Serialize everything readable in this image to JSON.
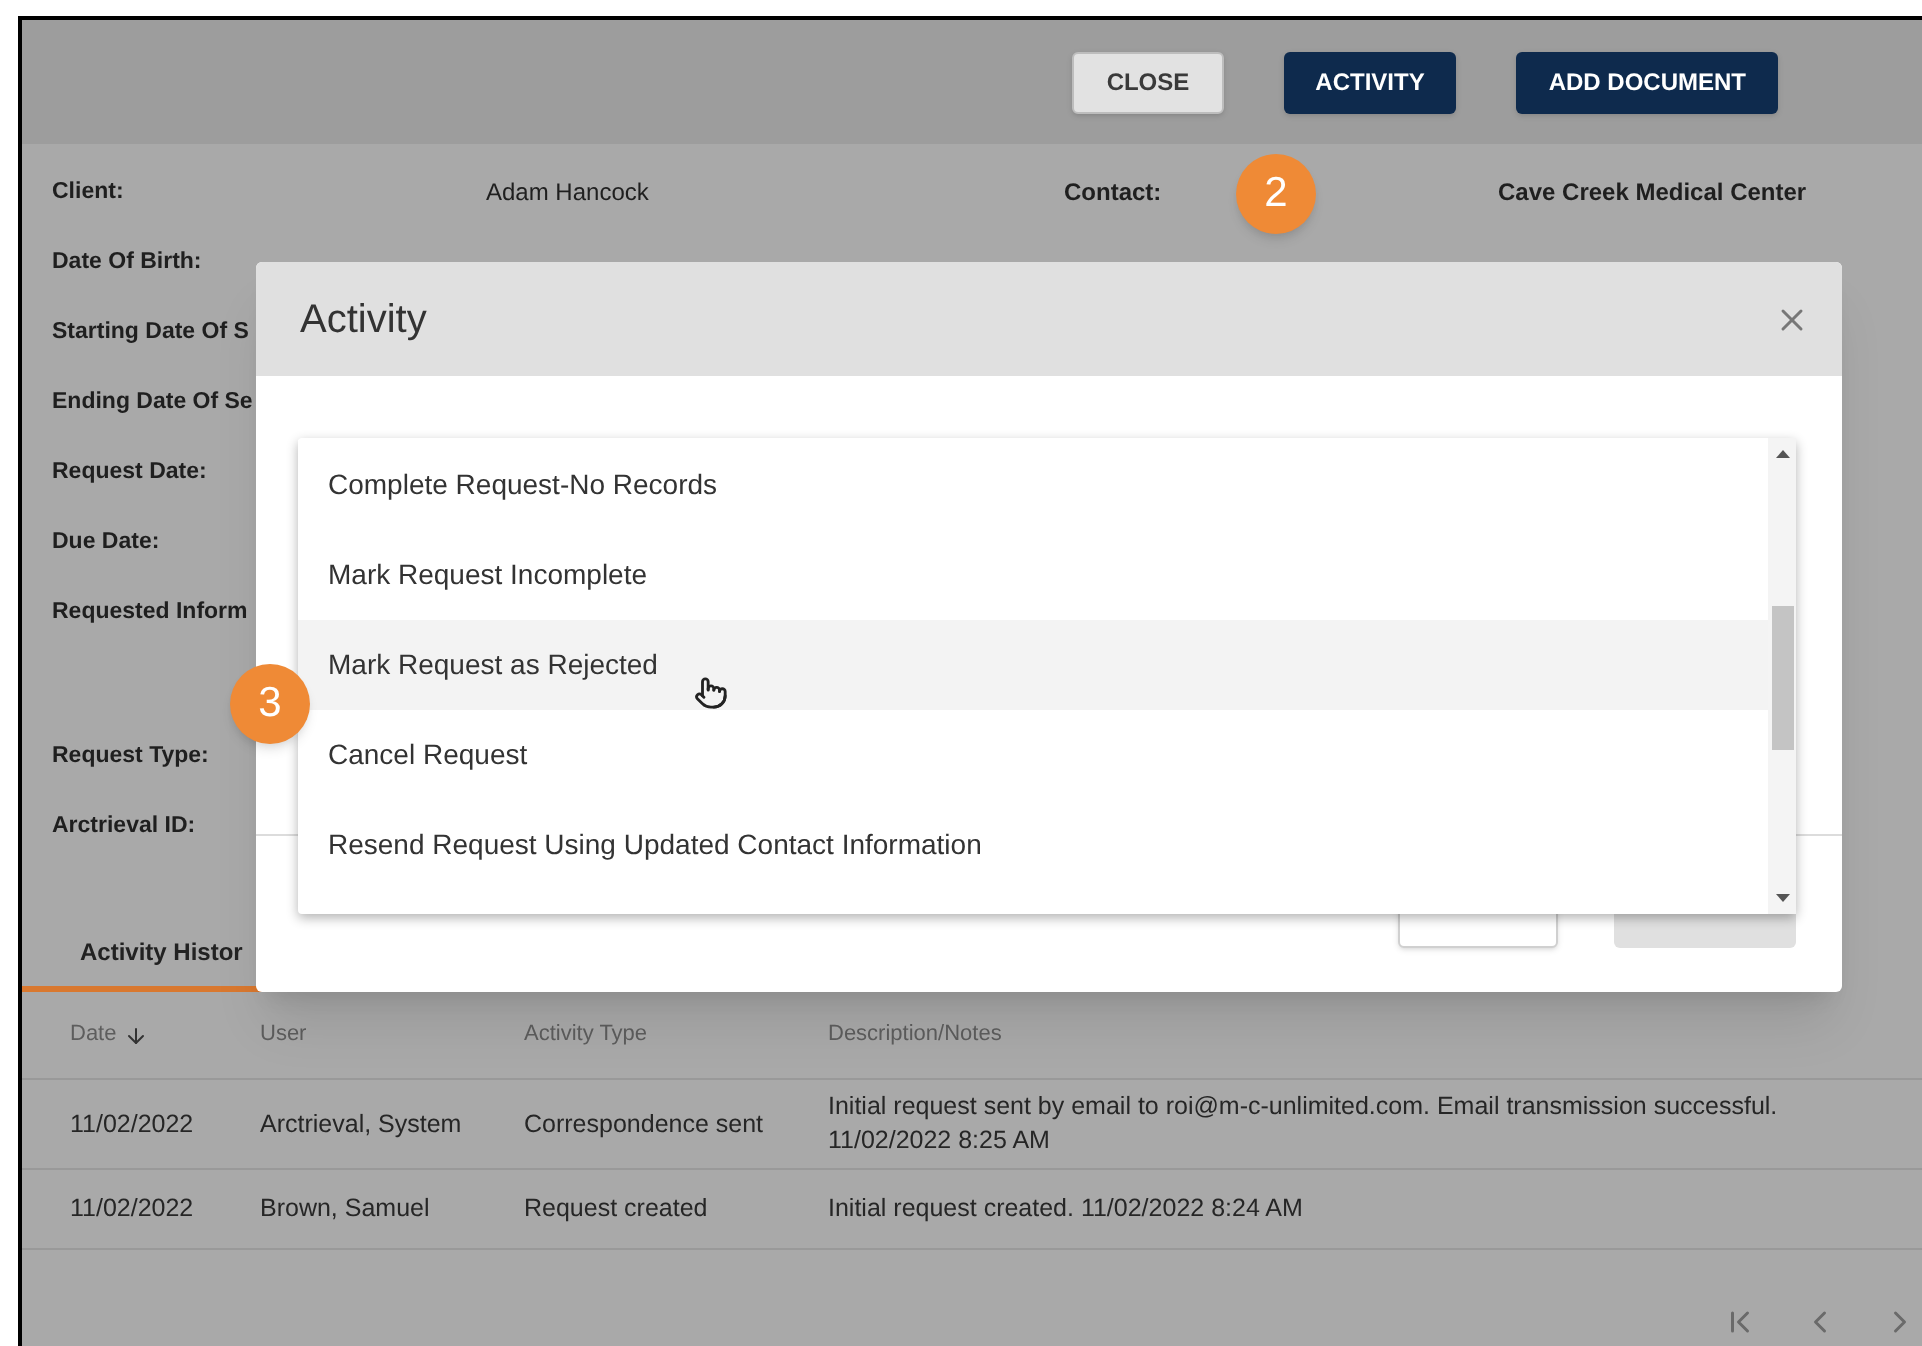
{
  "header": {
    "buttons": [
      {
        "label": "CLOSE",
        "kind": "secondary"
      },
      {
        "label": "ACTIVITY",
        "kind": "primary"
      },
      {
        "label": "ADD DOCUMENT",
        "kind": "primary"
      }
    ]
  },
  "callouts": [
    {
      "label": "2"
    },
    {
      "label": "3"
    }
  ],
  "details": [
    {
      "label": "Client:",
      "value": "Adam Hancock",
      "label_2": "Contact:",
      "value_2": "Cave Creek Medical Center"
    },
    {
      "label": "Date Of Birth:"
    },
    {
      "label": "Starting Date Of S"
    },
    {
      "label": "Ending Date Of Se"
    },
    {
      "label": "Request Date:"
    },
    {
      "label": "Due Date:"
    },
    {
      "label": "Requested Inform"
    }
  ],
  "details_more": [
    {
      "label": "Request Type:"
    },
    {
      "label": "Arctrieval ID:"
    }
  ],
  "modal": {
    "title": "Activity",
    "options": [
      {
        "label": "Complete Request-No Records",
        "selected": false
      },
      {
        "label": "Mark Request Incomplete",
        "selected": false
      },
      {
        "label": "Mark Request as Rejected",
        "selected": true
      },
      {
        "label": "Cancel Request",
        "selected": false
      },
      {
        "label": "Resend Request Using Updated Contact Information",
        "selected": false
      }
    ]
  },
  "tabs": [
    {
      "label": "Activity Histor",
      "selected": true
    }
  ],
  "table": {
    "columns": [
      {
        "label": "Date",
        "sorted": true
      },
      {
        "label": "User",
        "sorted": false
      },
      {
        "label": "Activity Type",
        "sorted": false
      },
      {
        "label": "Description/Notes",
        "sorted": false
      }
    ],
    "rows": [
      [
        "11/02/2022",
        "Arctrieval, System",
        "Correspondence sent",
        "Initial request sent by email to roi@m-c-unlimited.com. Email transmission successful. 11/02/2022 8:25 AM"
      ],
      [
        "11/02/2022",
        "Brown, Samuel",
        "Request created",
        "Initial request created. 11/02/2022 8:24 AM"
      ]
    ]
  }
}
